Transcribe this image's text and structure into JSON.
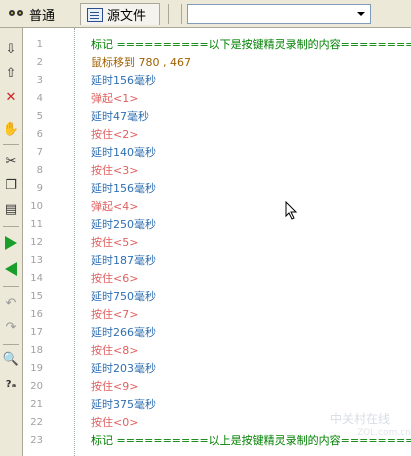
{
  "tabs": [
    {
      "label": "普通",
      "icon": "glasses-icon",
      "active": true
    },
    {
      "label": "源文件",
      "icon": "document-icon",
      "active": false
    }
  ],
  "dropdown": {
    "value": ""
  },
  "toolbar": {
    "icons": [
      "move-down-icon",
      "move-up-icon",
      "delete-icon",
      "hand-icon",
      "cut-icon",
      "copy-icon",
      "paste-icon",
      "run-icon",
      "back-icon",
      "undo-icon",
      "redo-icon",
      "find-icon",
      "replace-icon"
    ]
  },
  "colors": {
    "marker": "#008000",
    "mouse": "#a06000",
    "delay": "#2f6fb0",
    "key": "#e06060",
    "gutter_text": "#a0a0a0"
  },
  "lines": [
    {
      "n": "1",
      "text": "标记 ==========以下是按键精灵录制的内容==========",
      "kind": "marker"
    },
    {
      "n": "2",
      "text": "鼠标移到 780 , 467",
      "kind": "mouse"
    },
    {
      "n": "3",
      "text": "延时156毫秒",
      "kind": "delay"
    },
    {
      "n": "4",
      "text": "弹起<1>",
      "kind": "key"
    },
    {
      "n": "5",
      "text": "延时47毫秒",
      "kind": "delay"
    },
    {
      "n": "6",
      "text": "按住<2>",
      "kind": "key"
    },
    {
      "n": "7",
      "text": "延时140毫秒",
      "kind": "delay"
    },
    {
      "n": "8",
      "text": "按住<3>",
      "kind": "key"
    },
    {
      "n": "9",
      "text": "延时156毫秒",
      "kind": "delay"
    },
    {
      "n": "10",
      "text": "弹起<4>",
      "kind": "key"
    },
    {
      "n": "11",
      "text": "延时250毫秒",
      "kind": "delay"
    },
    {
      "n": "12",
      "text": "按住<5>",
      "kind": "key"
    },
    {
      "n": "13",
      "text": "延时187毫秒",
      "kind": "delay"
    },
    {
      "n": "14",
      "text": "按住<6>",
      "kind": "key"
    },
    {
      "n": "15",
      "text": "延时750毫秒",
      "kind": "delay"
    },
    {
      "n": "16",
      "text": "按住<7>",
      "kind": "key"
    },
    {
      "n": "17",
      "text": "延时266毫秒",
      "kind": "delay"
    },
    {
      "n": "18",
      "text": "按住<8>",
      "kind": "key"
    },
    {
      "n": "19",
      "text": "延时203毫秒",
      "kind": "delay"
    },
    {
      "n": "20",
      "text": "按住<9>",
      "kind": "key"
    },
    {
      "n": "21",
      "text": "延时375毫秒",
      "kind": "delay"
    },
    {
      "n": "22",
      "text": "按住<0>",
      "kind": "key"
    },
    {
      "n": "23",
      "text": "标记 ==========以上是按键精灵录制的内容==========",
      "kind": "marker"
    }
  ],
  "watermark": {
    "text": "中关村在线",
    "sub": "ZOL.com.cn"
  }
}
